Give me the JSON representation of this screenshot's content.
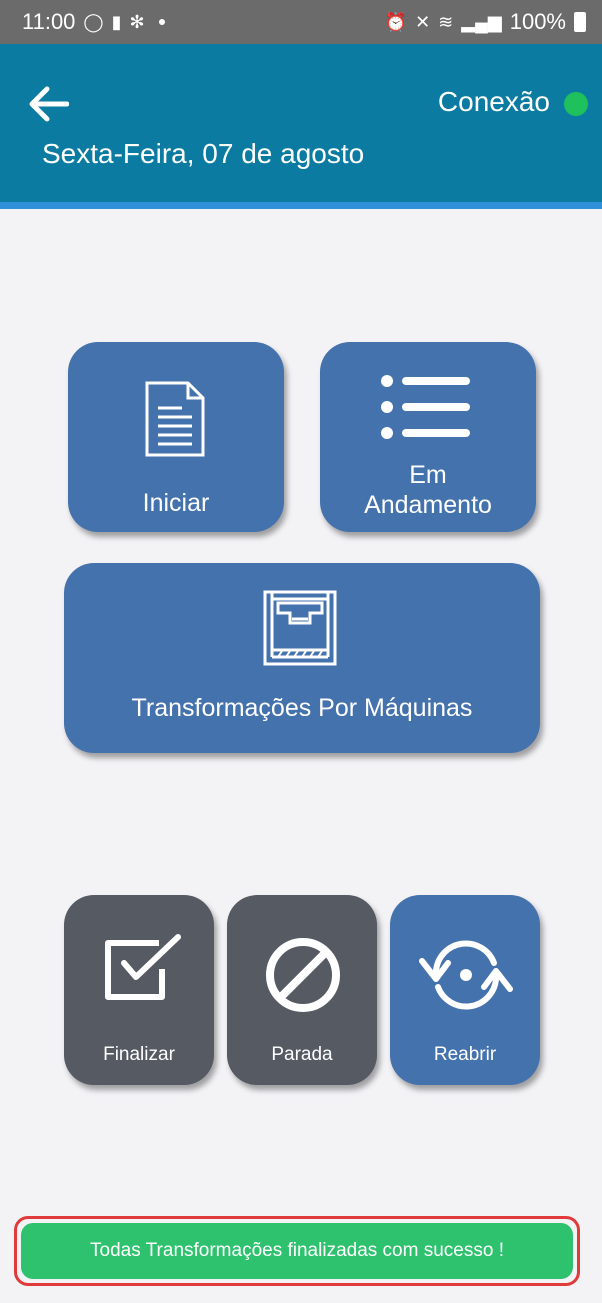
{
  "status_bar": {
    "time": "11:00",
    "battery": "100%"
  },
  "header": {
    "connection_label": "Conexão",
    "date": "Sexta-Feira, 07 de agosto",
    "connection_color": "#1fc15c",
    "background": "#0b7ba1"
  },
  "tiles": {
    "iniciar": {
      "label": "Iniciar",
      "icon": "document-icon"
    },
    "andamento": {
      "label_line1": "Em",
      "label_line2": "Andamento",
      "icon": "list-icon"
    },
    "transformacoes": {
      "label": "Transformações Por Máquinas",
      "icon": "machine-press-icon"
    },
    "finalizar": {
      "label": "Finalizar",
      "icon": "checkbox-icon"
    },
    "parada": {
      "label": "Parada",
      "icon": "prohibited-icon"
    },
    "reabrir": {
      "label": "Reabrir",
      "icon": "refresh-icon"
    }
  },
  "toast": {
    "message": "Todas Transformações finalizadas com sucesso !",
    "color": "#2ec26e"
  },
  "colors": {
    "tile_blue": "#4472ad",
    "tile_gray": "#555a63"
  }
}
